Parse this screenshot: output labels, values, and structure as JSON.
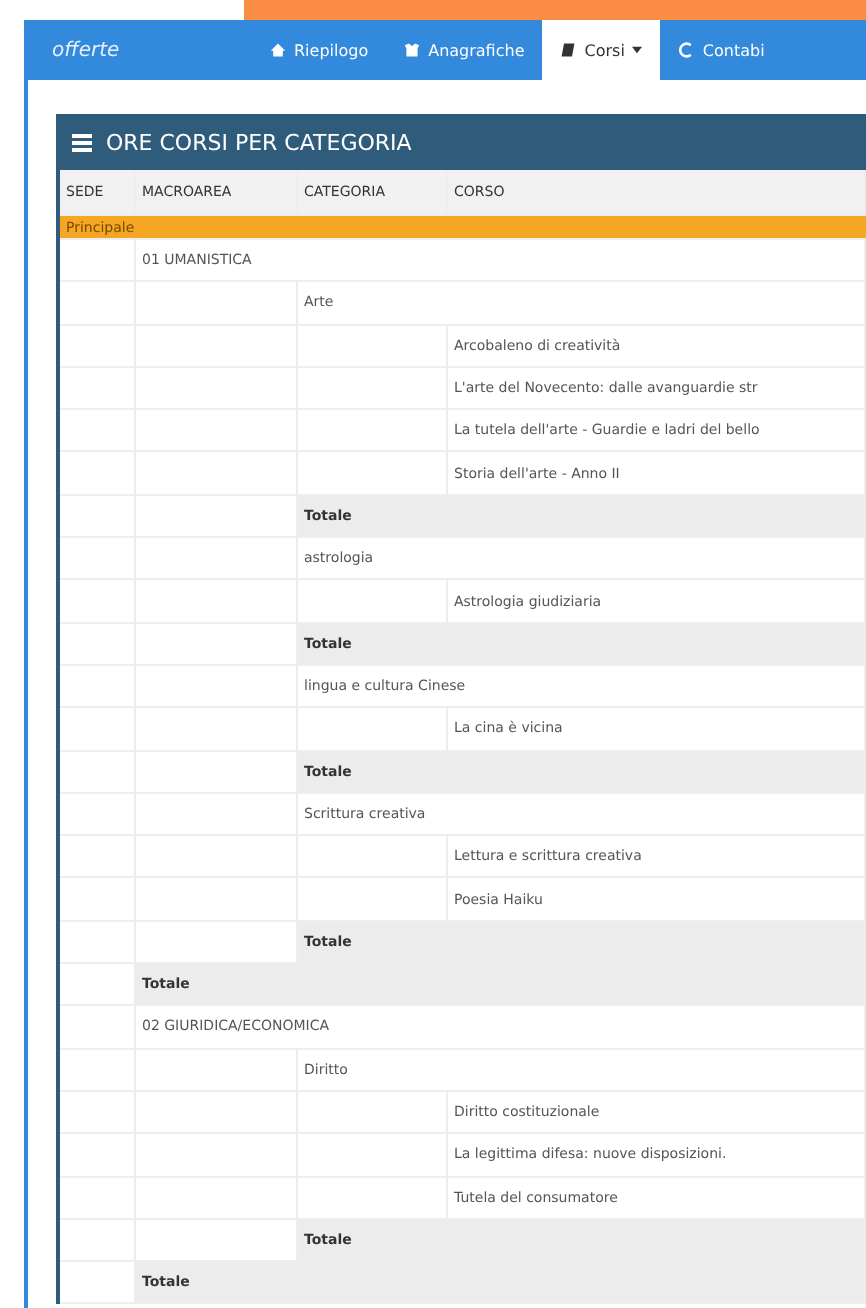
{
  "navbar": {
    "logo": "offerte",
    "tabs": [
      {
        "label": "Riepilogo",
        "selected": false,
        "dropdown": false
      },
      {
        "label": "Anagrafiche",
        "selected": false,
        "dropdown": false
      },
      {
        "label": "Corsi",
        "selected": true,
        "dropdown": true
      },
      {
        "label": "Contabi",
        "selected": false,
        "dropdown": false
      }
    ]
  },
  "panel": {
    "title": "ORE CORSI PER CATEGORIA",
    "columns": [
      "SEDE",
      "MACROAREA",
      "CATEGORIA",
      "CORSO"
    ],
    "rows": [
      {
        "text": "Principale",
        "children": [
          {
            "text": "01 UMANISTICA",
            "total": "Totale",
            "children": [
              {
                "text": "Arte",
                "total": "Totale",
                "children": [
                  {
                    "text": "Arcobaleno di creatività"
                  },
                  {
                    "text": "L'arte del Novecento: dalle avanguardie str"
                  },
                  {
                    "text": "La tutela dell'arte - Guardie e ladri del bello"
                  },
                  {
                    "text": "Storia dell'arte - Anno II"
                  }
                ]
              },
              {
                "text": "astrologia",
                "total": "Totale",
                "children": [
                  {
                    "text": "Astrologia giudiziaria"
                  }
                ]
              },
              {
                "text": "lingua e cultura Cinese",
                "total": "Totale",
                "children": [
                  {
                    "text": "La cina è vicina"
                  }
                ]
              },
              {
                "text": "Scrittura creativa",
                "total": "Totale",
                "children": [
                  {
                    "text": "Lettura e scrittura creativa"
                  },
                  {
                    "text": "Poesia Haiku"
                  }
                ]
              }
            ]
          },
          {
            "text": "02 GIURIDICA/ECONOMICA",
            "total": "Totale",
            "children": [
              {
                "text": "Diritto",
                "total": "Totale",
                "children": [
                  {
                    "text": "Diritto costituzionale"
                  },
                  {
                    "text": "La legittima difesa: nuove disposizioni."
                  },
                  {
                    "text": "Tutela del consumatore"
                  }
                ]
              }
            ]
          }
        ]
      }
    ]
  }
}
